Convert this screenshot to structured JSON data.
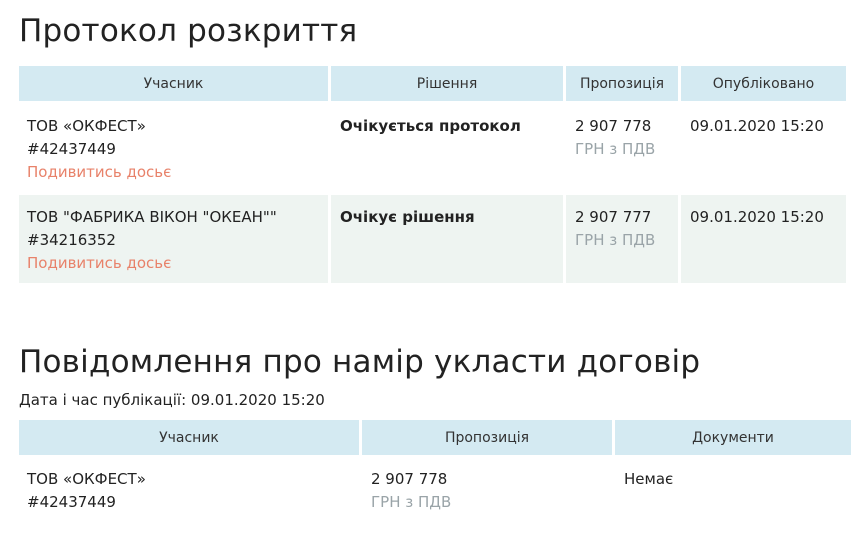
{
  "opening_protocol": {
    "title": "Протокол розкриття",
    "headers": [
      "Учасник",
      "Рішення",
      "Пропозиція",
      "Опубліковано"
    ],
    "rows": [
      {
        "name": "ТОВ «ОКФЕСТ»",
        "id": "#42437449",
        "dossier_link": "Подивитись досьє",
        "decision": "Очікується протокол",
        "amount": "2 907 778",
        "currency": "ГРН з ПДВ",
        "published": "09.01.2020 15:20"
      },
      {
        "name": "ТОВ \"ФАБРИКА ВІКОН \"ОКЕАН\"\"",
        "id": "#34216352",
        "dossier_link": "Подивитись досьє",
        "decision": "Очікує рішення",
        "amount": "2 907 777",
        "currency": "ГРН з ПДВ",
        "published": "09.01.2020 15:20"
      }
    ]
  },
  "intent_notice": {
    "title": "Повідомлення про намір укласти договір",
    "date_line": "Дата і час публікації: 09.01.2020 15:20",
    "headers": [
      "Учасник",
      "Пропозиція",
      "Документи"
    ],
    "rows": [
      {
        "name": "ТОВ «ОКФЕСТ»",
        "id": "#42437449",
        "amount": "2 907 778",
        "currency": "ГРН з ПДВ",
        "documents": "Немає"
      }
    ]
  }
}
